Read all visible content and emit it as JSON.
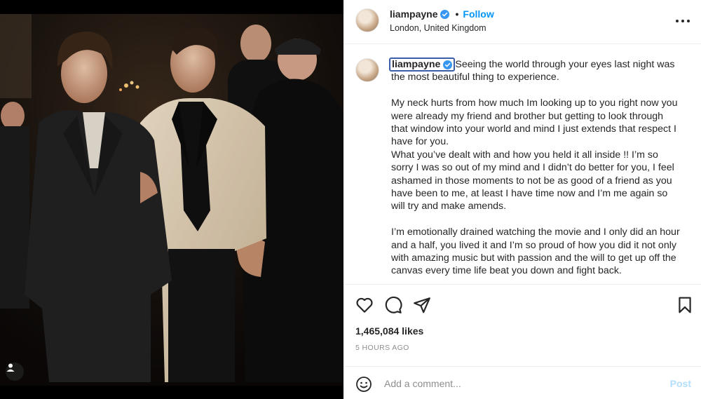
{
  "post": {
    "username": "liampayne",
    "follow_label": "Follow",
    "dot": "•",
    "location": "London, United Kingdom",
    "caption_username": "liampayne",
    "caption_paragraphs": [
      {
        "text": "Seeing the world through your eyes last night was the most beautiful thing to experience.",
        "gap": false
      },
      {
        "text": "My neck hurts from how much Im looking up to you right now you were already my friend and brother but getting to look through that window into your world and mind I just extends that respect I have for you.",
        "gap": true
      },
      {
        "text": "What you’ve dealt with and how you held it all inside !! I’m so sorry I was so out of my mind and I didn’t do better for you, I feel ashamed in those moments to not be as good of a friend as you have been to me, at least I have time now and I’m me again so will try and make amends.",
        "gap": false
      },
      {
        "text": "I’m emotionally drained watching the movie and I only did an hour and a half, you lived it and I’m so proud of how you did it not only with amazing music but with passion and the will to get up off the canvas every time life beat you down and fight back.",
        "gap": true
      }
    ],
    "likes": "1,465,084 likes",
    "time": "5 HOURS AGO",
    "comment_placeholder": "Add a comment...",
    "post_label": "Post"
  },
  "icons": {
    "verified": "verified-badge-icon",
    "more": "more-options-icon",
    "like": "heart-icon",
    "comment": "comment-bubble-icon",
    "share": "paper-plane-icon",
    "save": "bookmark-icon",
    "emoji": "smiley-icon",
    "tag": "user-tag-icon"
  },
  "colors": {
    "accent": "#0095f6",
    "verified": "#3897f0",
    "post_disabled": "#b2dffc",
    "muted": "#8e8e8e",
    "text": "#262626"
  }
}
